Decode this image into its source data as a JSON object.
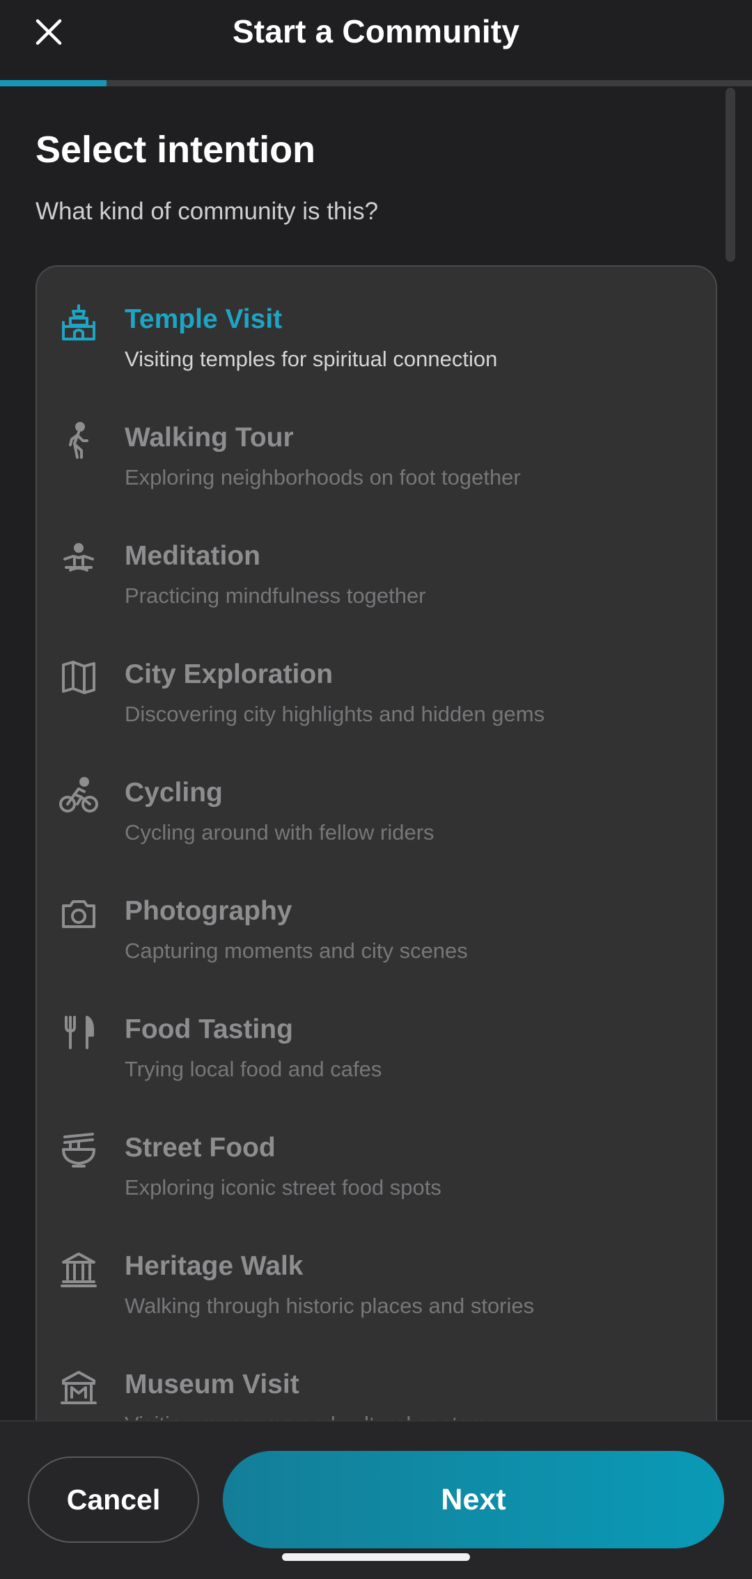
{
  "header": {
    "title": "Start a Community",
    "close_icon": "close-icon"
  },
  "progress": {
    "fraction": 0.142,
    "accent": "#1597b5"
  },
  "main": {
    "title": "Select intention",
    "subtitle": "What kind of community is this?"
  },
  "options": [
    {
      "title": "Temple Visit",
      "description": "Visiting temples for spiritual connection",
      "icon": "temple-icon",
      "selected": true
    },
    {
      "title": "Walking Tour",
      "description": "Exploring neighborhoods on foot together",
      "icon": "walking-icon",
      "selected": false
    },
    {
      "title": "Meditation",
      "description": "Practicing mindfulness together",
      "icon": "meditation-icon",
      "selected": false
    },
    {
      "title": "City Exploration",
      "description": "Discovering city highlights and hidden gems",
      "icon": "map-icon",
      "selected": false
    },
    {
      "title": "Cycling",
      "description": "Cycling around with fellow riders",
      "icon": "bicycle-icon",
      "selected": false
    },
    {
      "title": "Photography",
      "description": "Capturing moments and city scenes",
      "icon": "camera-icon",
      "selected": false
    },
    {
      "title": "Food Tasting",
      "description": "Trying local food and cafes",
      "icon": "fork-knife-icon",
      "selected": false
    },
    {
      "title": "Street Food",
      "description": "Exploring iconic street food spots",
      "icon": "noodle-bowl-icon",
      "selected": false
    },
    {
      "title": "Heritage Walk",
      "description": "Walking through historic places and stories",
      "icon": "heritage-building-icon",
      "selected": false
    },
    {
      "title": "Museum Visit",
      "description": "Visiting museums and cultural centers",
      "icon": "museum-icon",
      "selected": false
    }
  ],
  "footer": {
    "cancel_label": "Cancel",
    "next_label": "Next"
  },
  "colors": {
    "accent": "#1ea5c3",
    "background": "#1f1f21",
    "card": "#323233"
  }
}
